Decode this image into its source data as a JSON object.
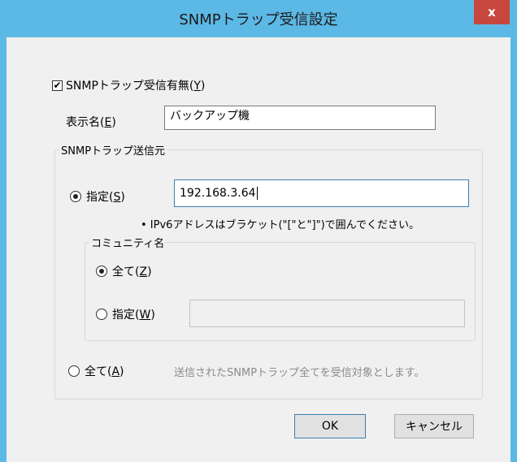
{
  "window": {
    "title": "SNMPトラップ受信設定",
    "close_label": "x"
  },
  "enable": {
    "label_main": "SNMPトラップ受信有無(",
    "label_key": "Y",
    "label_end": ")",
    "checked": true
  },
  "display_name": {
    "label_main": "表示名(",
    "label_key": "E",
    "label_end": ")",
    "value": "バックアップ機"
  },
  "source_group": {
    "legend": "SNMPトラップ送信元",
    "specify": {
      "label_main": "指定(",
      "label_key": "S",
      "label_end": ")",
      "selected": true,
      "value": "192.168.3.64"
    },
    "ipv6_note": "• IPv6アドレスはブラケット(\"[\"と\"]\")で囲んでください。",
    "community": {
      "legend": "コミュニティ名",
      "all": {
        "label_main": "全て(",
        "label_key": "Z",
        "label_end": ")",
        "selected": true
      },
      "specify": {
        "label_main": "指定(",
        "label_key": "W",
        "label_end": ")",
        "selected": false,
        "value": ""
      }
    },
    "all": {
      "label_main": "全て(",
      "label_key": "A",
      "label_end": ")",
      "selected": false,
      "description": "送信されたSNMPトラップ全てを受信対象とします。"
    }
  },
  "buttons": {
    "ok": "OK",
    "cancel": "キャンセル"
  }
}
